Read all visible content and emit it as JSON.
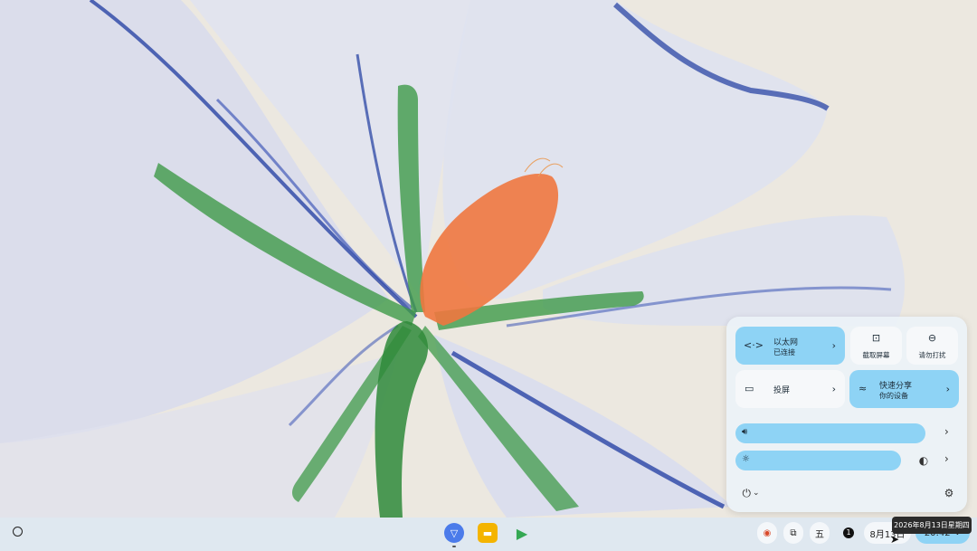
{
  "quick_settings": {
    "ethernet": {
      "title": "以太网",
      "status": "已连接",
      "icon": "ethernet-icon"
    },
    "screenshot": {
      "label": "截取屏幕",
      "icon": "screen-capture-icon"
    },
    "dnd": {
      "label": "请勿打扰",
      "icon": "do-not-disturb-icon"
    },
    "cast": {
      "label": "投屏",
      "icon": "cast-icon"
    },
    "nearby_share": {
      "title": "快速分享",
      "status": "你的设备",
      "icon": "nearby-share-icon"
    },
    "volume": {
      "icon": "volume-icon",
      "level": 1.0
    },
    "brightness": {
      "icon": "brightness-icon",
      "level": 1.0
    },
    "night_light": {
      "icon": "night-light-off-icon"
    },
    "power": {
      "icon": "power-icon"
    },
    "settings": {
      "icon": "gear-icon"
    }
  },
  "shelf": {
    "apps": [
      {
        "name": "app-icon-1",
        "color": "#4b7bea"
      },
      {
        "name": "files-app-icon",
        "color": "#f4b400"
      },
      {
        "name": "play-store-icon",
        "color": "#34a853"
      }
    ],
    "ime": "五",
    "notification_count": "1",
    "date": "8月13日",
    "time": "20:42"
  },
  "tooltip": "2026年8月13日星期四",
  "colors": {
    "tile_on": "#8ed3f5",
    "shelf": "#dee8f0",
    "time_pill": "#8ed3f5"
  }
}
